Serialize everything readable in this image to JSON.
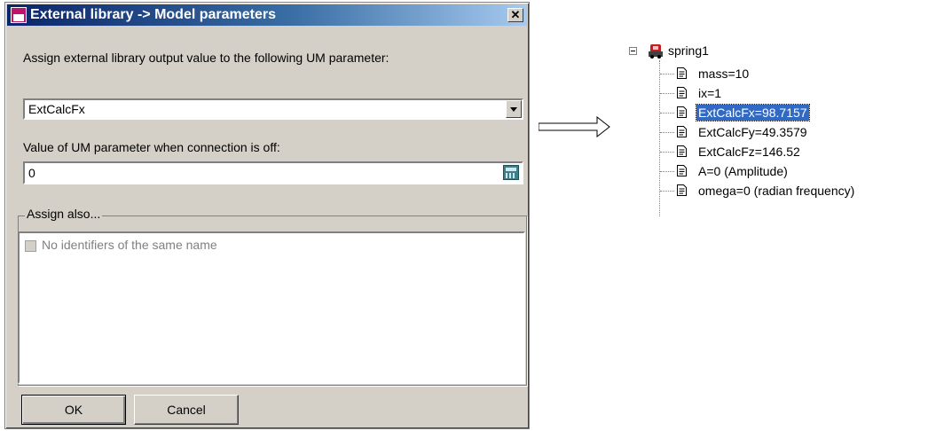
{
  "dialog": {
    "title": "External library -> Model parameters",
    "assign_label": "Assign external library output value to the following UM parameter:",
    "combo_value": "ExtCalcFx",
    "off_value_label": "Value of UM parameter when connection is off:",
    "off_value": "0",
    "group_label": "Assign also...",
    "checkbox_label": "No identifiers of the same name",
    "ok_label": "OK",
    "cancel_label": "Cancel"
  },
  "tree": {
    "root": "spring1",
    "items": [
      {
        "label": "mass=10",
        "selected": false
      },
      {
        "label": "ix=1",
        "selected": false
      },
      {
        "label": "ExtCalcFx=98.7157",
        "selected": true
      },
      {
        "label": "ExtCalcFy=49.3579",
        "selected": false
      },
      {
        "label": "ExtCalcFz=146.52",
        "selected": false
      },
      {
        "label": "A=0 (Amplitude)",
        "selected": false
      },
      {
        "label": "omega=0 (radian frequency)",
        "selected": false
      }
    ]
  },
  "colors": {
    "titlebar_start": "#0a246a",
    "selection": "#316ac5",
    "dialog_face": "#d4d0c8"
  }
}
